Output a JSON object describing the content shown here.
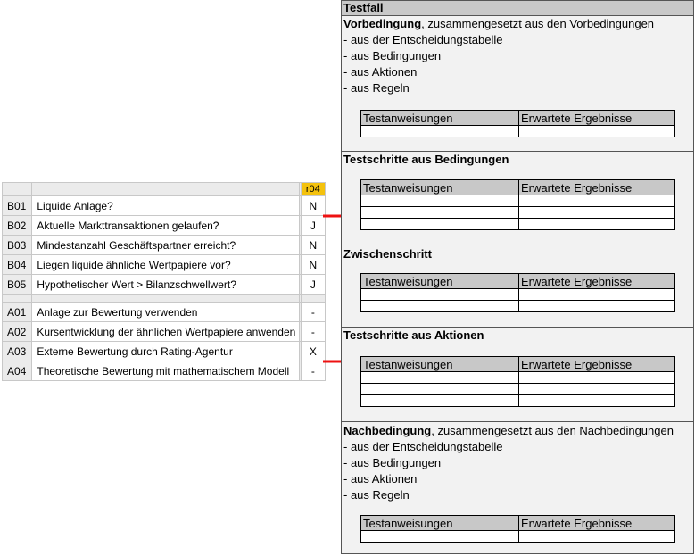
{
  "decision_table": {
    "rule_label": "r04",
    "conditions": [
      {
        "id": "B01",
        "text": "Liquide Anlage?",
        "value": "N"
      },
      {
        "id": "B02",
        "text": "Aktuelle Markttransaktionen gelaufen?",
        "value": "J"
      },
      {
        "id": "B03",
        "text": "Mindestanzahl Geschäftspartner erreicht?",
        "value": "N"
      },
      {
        "id": "B04",
        "text": "Liegen liquide ähnliche Wertpapiere vor?",
        "value": "N"
      },
      {
        "id": "B05",
        "text": "Hypothetischer Wert > Bilanzschwellwert?",
        "value": "J"
      }
    ],
    "actions": [
      {
        "id": "A01",
        "text": "Anlage zur Bewertung verwenden",
        "value": "-"
      },
      {
        "id": "A02",
        "text": "Kursentwicklung der ähnlichen Wertpapiere anwenden",
        "value": "-"
      },
      {
        "id": "A03",
        "text": "Externe Bewertung durch Rating-Agentur",
        "value": "X"
      },
      {
        "id": "A04",
        "text": "Theoretische Bewertung mit mathematischem Modell",
        "value": "-"
      }
    ]
  },
  "colors": {
    "rule_header": "#f4c20d",
    "arrow": "#ee1111",
    "header_fill": "#c8c8c8"
  },
  "test_case": {
    "title": "Testfall",
    "col_instructions": "Testanweisungen",
    "col_expected": "Erwartete Ergebnisse",
    "precondition": {
      "title": "Vorbedingung",
      "suffix": ", zusammengesetzt aus den Vorbedingungen",
      "items": [
        "- aus der Entscheidungstabelle",
        "- aus Bedingungen",
        "- aus Aktionen",
        "- aus Regeln"
      ]
    },
    "steps_conditions": {
      "title": "Testschritte aus Bedingungen"
    },
    "intermediate": {
      "title": "Zwischenschritt"
    },
    "steps_actions": {
      "title": "Testschritte aus Aktionen"
    },
    "postcondition": {
      "title": "Nachbedingung",
      "suffix": ", zusammengesetzt aus den Nachbedingungen",
      "items": [
        "- aus der Entscheidungstabelle",
        "- aus Bedingungen",
        "- aus Aktionen",
        "- aus Regeln"
      ]
    }
  }
}
